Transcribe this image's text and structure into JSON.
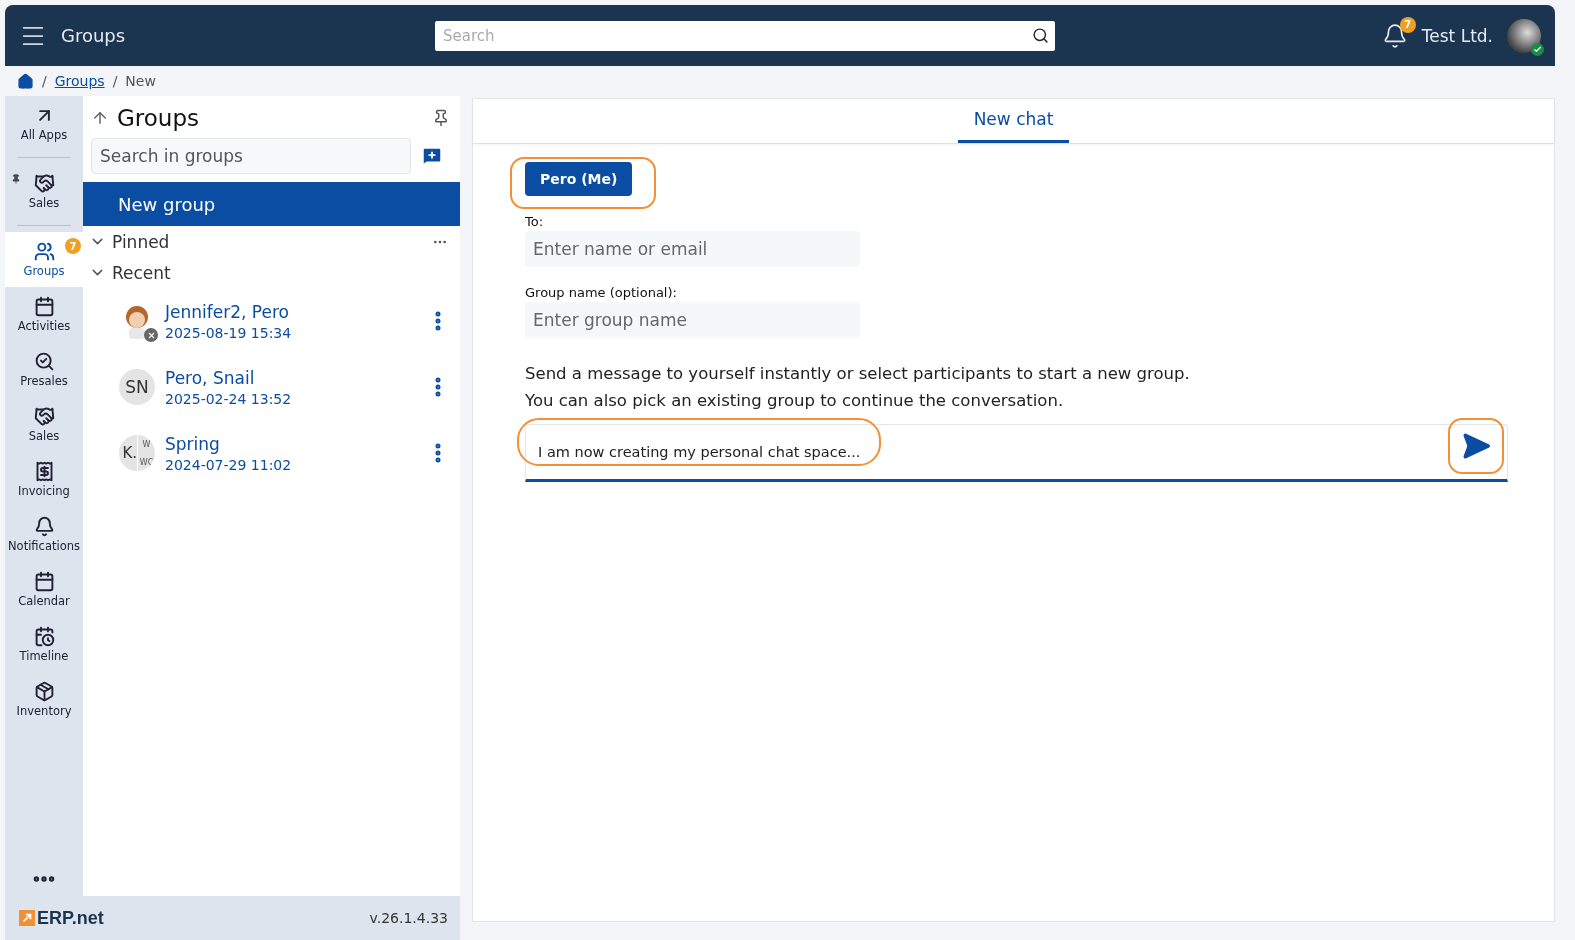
{
  "header": {
    "title": "Groups",
    "search": {
      "placeholder": "Search"
    },
    "notifications": "7",
    "company": "Test Ltd."
  },
  "breadcrumb": [
    {
      "separator": "/",
      "label": "Groups",
      "kind": "link"
    },
    {
      "separator": "/",
      "label": "New",
      "kind": "text"
    }
  ],
  "rail": [
    {
      "label": "All Apps",
      "selected": false,
      "pinned": false
    },
    {
      "label": "Sales",
      "selected": false,
      "pinned": true
    },
    {
      "label": "Groups",
      "selected": true,
      "pinned": false,
      "badge": "7"
    },
    {
      "label": "Activities",
      "selected": false,
      "pinned": false
    },
    {
      "label": "Presales",
      "selected": false,
      "pinned": false
    },
    {
      "label": "Sales",
      "selected": false,
      "pinned": false
    },
    {
      "label": "Invoicing",
      "selected": false,
      "pinned": false
    },
    {
      "label": "Notifications",
      "selected": false,
      "pinned": false
    },
    {
      "label": "Calendar",
      "selected": false,
      "pinned": false
    },
    {
      "label": "Timeline",
      "selected": false,
      "pinned": false
    },
    {
      "label": "Inventory",
      "selected": false,
      "pinned": false
    }
  ],
  "groups_panel": {
    "title": "Groups",
    "search": {
      "placeholder": "Search in groups"
    },
    "new_group": "New group",
    "sections": [
      "Pinned",
      "Recent"
    ],
    "items": [
      {
        "name": "Jennifer2, Pero",
        "time": "2025-08-19 15:34",
        "kind": "picture"
      },
      {
        "name": "Pero, Snail",
        "time": "2025-02-24 13:52",
        "kind": "initials",
        "initials": "SN"
      },
      {
        "name": "Spring",
        "time": "2024-07-29 11:02",
        "kind": "split",
        "initials": "K.",
        "parts": [
          "W",
          "WC"
        ]
      }
    ]
  },
  "footer": {
    "logo": "ERP.net",
    "version": "v.26.1.4.33"
  },
  "chat": {
    "tabs": [
      {
        "label": "New chat",
        "selected": true
      }
    ],
    "me_chip": "Pero (Me)",
    "to": {
      "label": "To:",
      "placeholder": "Enter name or email"
    },
    "group_name": {
      "label": "Group name (optional):",
      "placeholder": "Enter group name"
    },
    "hint": [
      "Send a message to yourself instantly or select participants to start a new group.",
      "You can also pick an existing group to continue the conversation."
    ],
    "message": "I am now creating my personal chat space..."
  }
}
